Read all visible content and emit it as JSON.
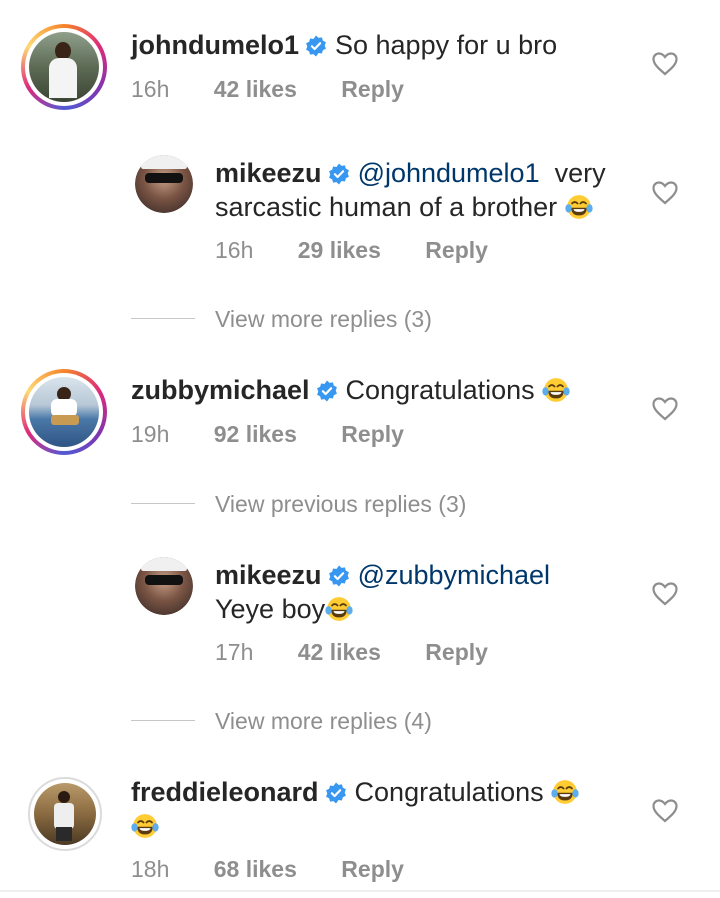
{
  "comments": [
    {
      "user": "johndumelo1",
      "text": "So happy for u bro",
      "time": "16h",
      "likes": "42 likes",
      "reply": "Reply"
    },
    {
      "user": "mikeezu",
      "mention": "@johndumelo1",
      "text_a": "very",
      "text_b": "sarcastic human of a brother",
      "time": "16h",
      "likes": "29 likes",
      "reply": "Reply"
    },
    {
      "user": "zubbymichael",
      "text": "Congratulations",
      "time": "19h",
      "likes": "92 likes",
      "reply": "Reply"
    },
    {
      "user": "mikeezu",
      "mention": "@zubbymichael",
      "text_b": "Yeye boy",
      "time": "17h",
      "likes": "42 likes",
      "reply": "Reply"
    },
    {
      "user": "freddieleonard",
      "text": "Congratulations",
      "time": "18h",
      "likes": "68 likes",
      "reply": "Reply"
    }
  ],
  "view_more_1": "View more replies (3)",
  "view_previous": "View previous replies (3)",
  "view_more_2": "View more replies (4)",
  "icons": {
    "verified": "verified-badge-icon",
    "heart": "heart-outline-icon",
    "emoji": "tears-of-joy-emoji"
  },
  "colors": {
    "verified": "#3897f0",
    "mention": "#00376b",
    "meta": "#8e8e8e"
  }
}
